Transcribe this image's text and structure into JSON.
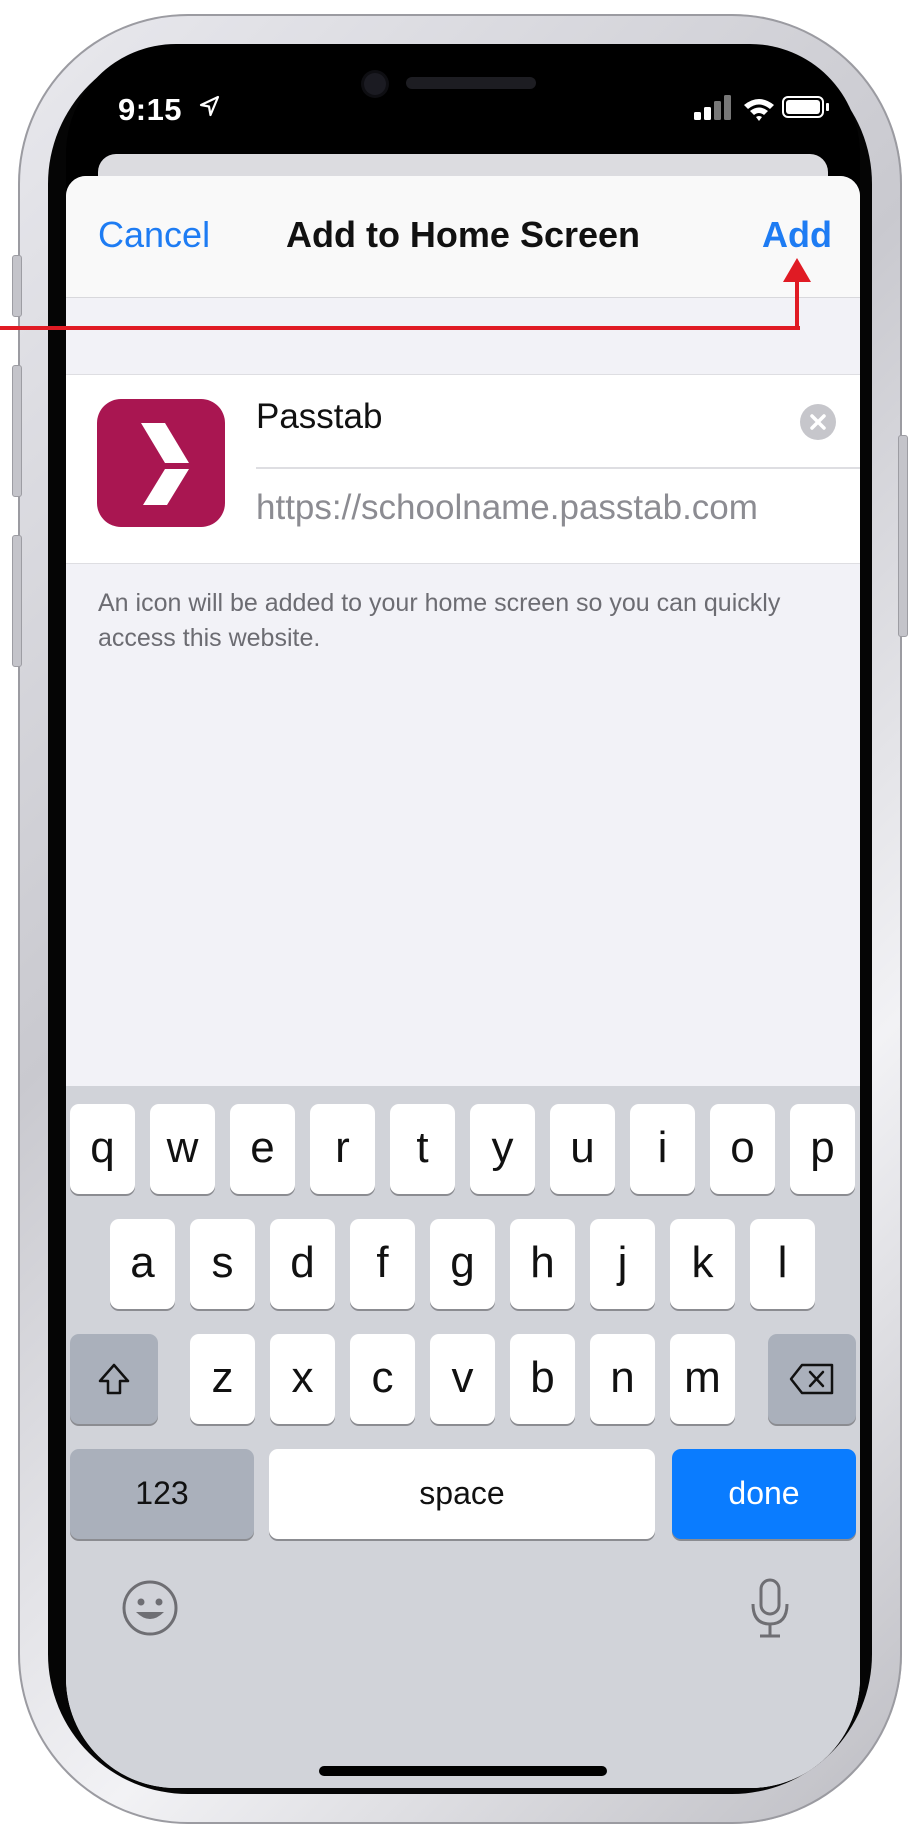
{
  "status_bar": {
    "time": "9:15"
  },
  "sheet": {
    "cancel_label": "Cancel",
    "title": "Add to Home Screen",
    "add_label": "Add"
  },
  "form": {
    "name_value": "Passtab",
    "url": "https://schoolname.passtab.com"
  },
  "hint": "An icon will be added to your home screen so you can quickly access this website.",
  "keyboard": {
    "row1": [
      "q",
      "w",
      "e",
      "r",
      "t",
      "y",
      "u",
      "i",
      "o",
      "p"
    ],
    "row2": [
      "a",
      "s",
      "d",
      "f",
      "g",
      "h",
      "j",
      "k",
      "l"
    ],
    "row3": [
      "z",
      "x",
      "c",
      "v",
      "b",
      "n",
      "m"
    ],
    "numbers_label": "123",
    "space_label": "space",
    "done_label": "done"
  },
  "colors": {
    "accent": "#1e7cf3",
    "app_icon": "#a91651",
    "done_key": "#0a7cff",
    "annotation": "#e01b24"
  },
  "icons": [
    "location-arrow-icon",
    "signal-icon",
    "wifi-icon",
    "battery-icon",
    "clear-icon",
    "passtab-logo-icon",
    "shift-icon",
    "delete-icon",
    "emoji-icon",
    "microphone-icon"
  ]
}
